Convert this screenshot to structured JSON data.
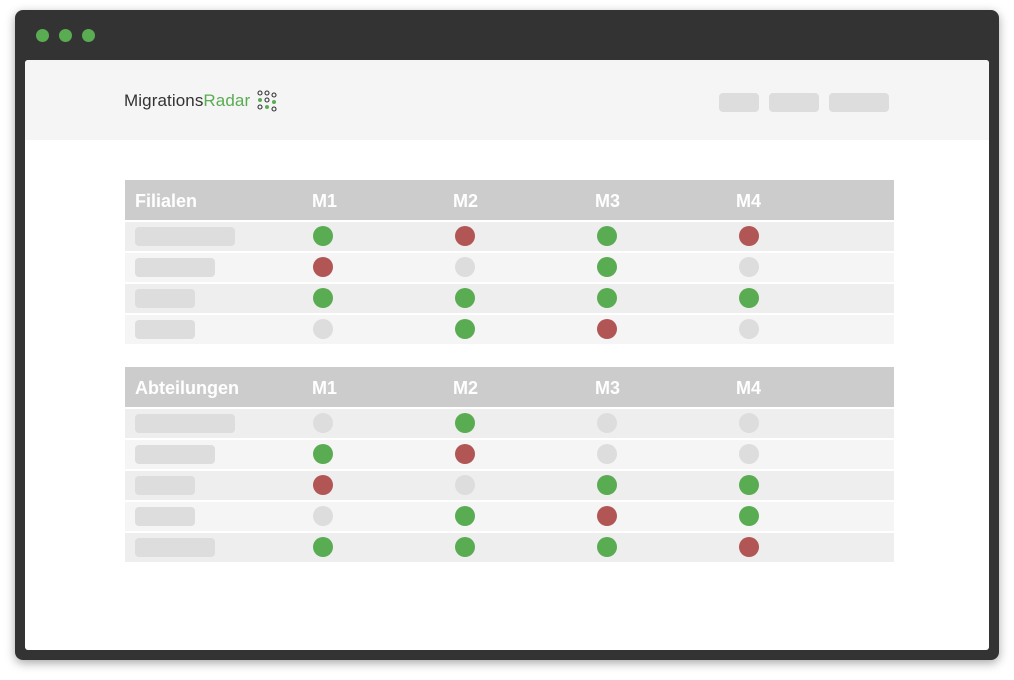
{
  "window": {
    "traffic_light_color": "#5aac52"
  },
  "header": {
    "logo_dark": "Migrations",
    "logo_green": "Radar",
    "nav_items": 3
  },
  "colors": {
    "green": "#5aac52",
    "red": "#b15555",
    "empty": "#dddddd",
    "header_bg": "#cccccc"
  },
  "tables": [
    {
      "title": "Filialen",
      "columns": [
        "M1",
        "M2",
        "M3",
        "M4"
      ],
      "rows": [
        {
          "name_length": "long",
          "status": [
            "green",
            "red",
            "green",
            "red"
          ]
        },
        {
          "name_length": "medium",
          "status": [
            "red",
            "empty",
            "green",
            "empty"
          ]
        },
        {
          "name_length": "short",
          "status": [
            "green",
            "green",
            "green",
            "green"
          ]
        },
        {
          "name_length": "short",
          "status": [
            "empty",
            "green",
            "red",
            "empty"
          ]
        }
      ]
    },
    {
      "title": "Abteilungen",
      "columns": [
        "M1",
        "M2",
        "M3",
        "M4"
      ],
      "rows": [
        {
          "name_length": "long",
          "status": [
            "empty",
            "green",
            "empty",
            "empty"
          ]
        },
        {
          "name_length": "medium",
          "status": [
            "green",
            "red",
            "empty",
            "empty"
          ]
        },
        {
          "name_length": "short",
          "status": [
            "red",
            "empty",
            "green",
            "green"
          ]
        },
        {
          "name_length": "short",
          "status": [
            "empty",
            "green",
            "red",
            "green"
          ]
        },
        {
          "name_length": "medium",
          "status": [
            "green",
            "green",
            "green",
            "red"
          ]
        }
      ]
    }
  ]
}
